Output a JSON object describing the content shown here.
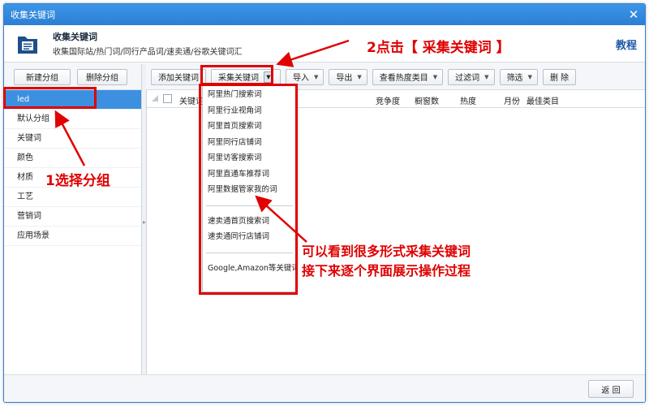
{
  "window": {
    "title": "收集关键词",
    "close_symbol": "✕"
  },
  "header": {
    "title": "收集关键词",
    "subtitle": "收集国际站/热门词/同行产品词/速卖通/谷歌关键词汇",
    "tutorial_label": "教程"
  },
  "left_panel": {
    "new_group_label": "新建分组",
    "delete_group_label": "删除分组",
    "groups": [
      "led",
      "默认分组",
      "关键词",
      "颜色",
      "材质",
      "工艺",
      "营销词",
      "应用场景"
    ]
  },
  "toolbar": {
    "add_keyword": "添加关键词",
    "collect_keyword": "采集关键词",
    "import": "导入",
    "export": "导出",
    "view_category": "查看热度类目",
    "filter_words": "过滤词",
    "filter": "筛选",
    "delete": "删 除"
  },
  "grid": {
    "columns": [
      "关键词",
      "竞争度",
      "橱窗数",
      "热度",
      "月份",
      "最佳类目"
    ]
  },
  "dropdown": {
    "items_group1": [
      "阿里热门搜索词",
      "阿里行业视角词",
      "阿里首页搜索词",
      "阿里同行店铺词",
      "阿里访客搜索词",
      "阿里直通车推荐词",
      "阿里数据管家我的词"
    ],
    "items_group2": [
      "速卖通首页搜索词",
      "速卖通同行店铺词"
    ],
    "items_group3": [
      "Google,Amazon等关键词"
    ]
  },
  "footer": {
    "back_label": "返 回"
  },
  "annotations": {
    "step1": "1选择分组",
    "step2": "2点击【 采集关键词 】",
    "note_line1": "可以看到很多形式采集关键词",
    "note_line2": "接下来逐个界面展示操作过程",
    "color": "#e00000"
  }
}
